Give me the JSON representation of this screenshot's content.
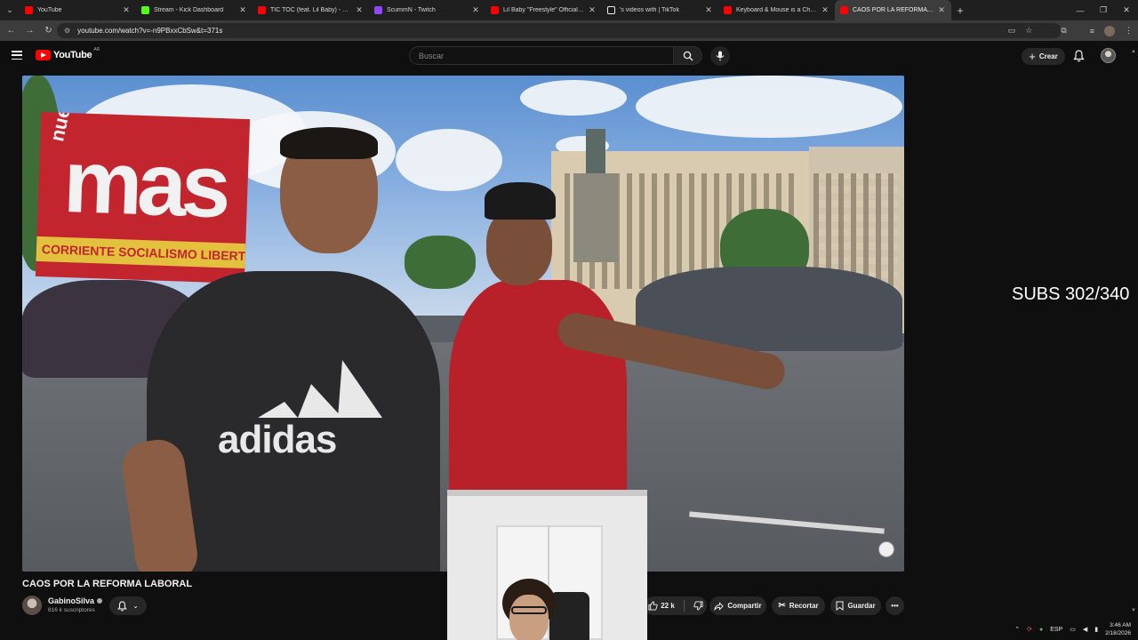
{
  "browser": {
    "tabs": [
      {
        "title": "YouTube",
        "color": "#ff0000"
      },
      {
        "title": "Stream - Kick Dashboard",
        "color": "#53fc18"
      },
      {
        "title": "TIC TOC (feat. Lil Baby) - YouTu",
        "color": "#ff0000"
      },
      {
        "title": "ScummN - Twitch",
        "color": "#9146ff"
      },
      {
        "title": "Lil Baby \"Freestyle\" Official Mu",
        "color": "#ff0000"
      },
      {
        "title": "'s videos with | TikTok",
        "color": "#ffffff"
      },
      {
        "title": "Keyboard & Mouse is a Cheat C",
        "color": "#ff0000"
      },
      {
        "title": "CAOS POR LA REFORMA LABO",
        "color": "#ff0000",
        "active": true
      }
    ],
    "url": "youtube.com/watch?v=-n9PBxxCbSw&t=371s"
  },
  "masthead": {
    "logo_text": "YouTube",
    "country_code": "AR",
    "search_placeholder": "Buscar",
    "create_label": "Crear"
  },
  "overlay": {
    "subs_text": "SUBS 302/340"
  },
  "video": {
    "title": "CAOS POR LA REFORMA LABORAL",
    "channel_name": "GabinoSilva",
    "channel_subs": "816 k suscriptores",
    "scene_banner": "mas",
    "scene_banner_prefix": "nuevo",
    "scene_strip": "CORRIENTE SOCIALISMO LIBERTARIO",
    "shirt_logo": "adidas"
  },
  "actions": {
    "likes": "22 k",
    "share_label": "Compartir",
    "clip_label": "Recortar",
    "save_label": "Guardar"
  },
  "taskbar": {
    "lang": "ESP",
    "time": "3:46 AM",
    "date": "2/18/2026"
  },
  "colors": {
    "accent": "#ff0000",
    "background": "#0f0f0f"
  }
}
